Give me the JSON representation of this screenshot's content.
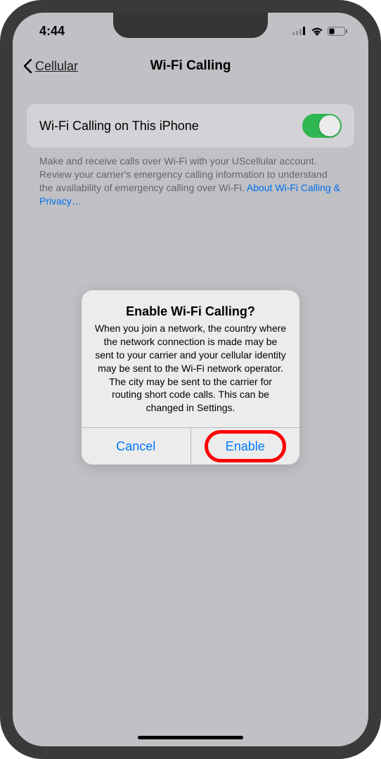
{
  "status": {
    "time": "4:44"
  },
  "nav": {
    "back_label": "Cellular",
    "title": "Wi-Fi Calling"
  },
  "setting": {
    "label": "Wi-Fi Calling on This iPhone",
    "enabled": true
  },
  "description": {
    "text": "Make and receive calls over Wi-Fi with your UScellular account. Review your carrier's emergency calling information to understand the availability of emergency calling over Wi-Fi. ",
    "link": "About Wi-Fi Calling & Privacy…"
  },
  "alert": {
    "title": "Enable Wi-Fi Calling?",
    "message": "When you join a network, the country where the network connection is made may be sent to your carrier and your cellular identity may be sent to the Wi-Fi network operator. The city may be sent to the carrier for routing short code calls. This can be changed in Settings.",
    "cancel_label": "Cancel",
    "enable_label": "Enable"
  }
}
